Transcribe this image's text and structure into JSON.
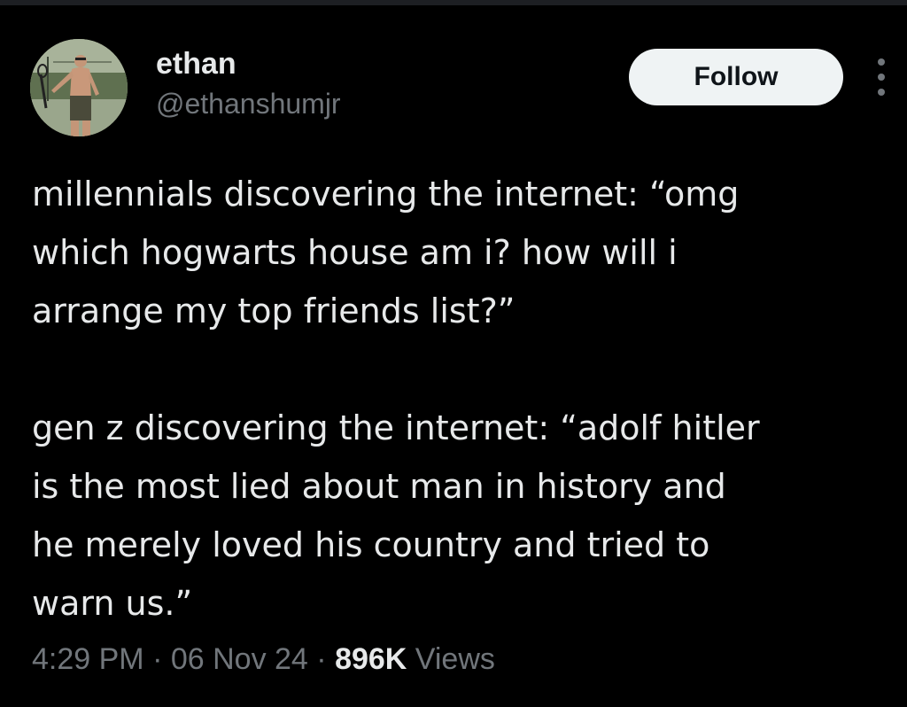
{
  "author": {
    "display_name": "ethan",
    "handle": "@ethanshumjr"
  },
  "actions": {
    "follow_label": "Follow",
    "more_icon": "more-vertical-icon"
  },
  "tweet": {
    "paragraphs": [
      {
        "lines": [
          "millennials discovering the internet: “omg",
          "which hogwarts house am i? how will i",
          "arrange my top friends list?”"
        ]
      },
      {
        "lines": [
          "gen z discovering the internet: “adolf hitler",
          "is the most lied about man in history and",
          "he merely loved his country and tried to",
          "warn us.”"
        ]
      }
    ]
  },
  "meta": {
    "time": "4:29 PM",
    "separator": " · ",
    "date": "06 Nov 24",
    "views_count": "896K",
    "views_label": " Views"
  },
  "colors": {
    "background": "#000000",
    "primary_text": "#e7e9ea",
    "secondary_text": "#71767b",
    "follow_button_bg": "#eff3f4",
    "follow_button_text": "#0f1419"
  }
}
